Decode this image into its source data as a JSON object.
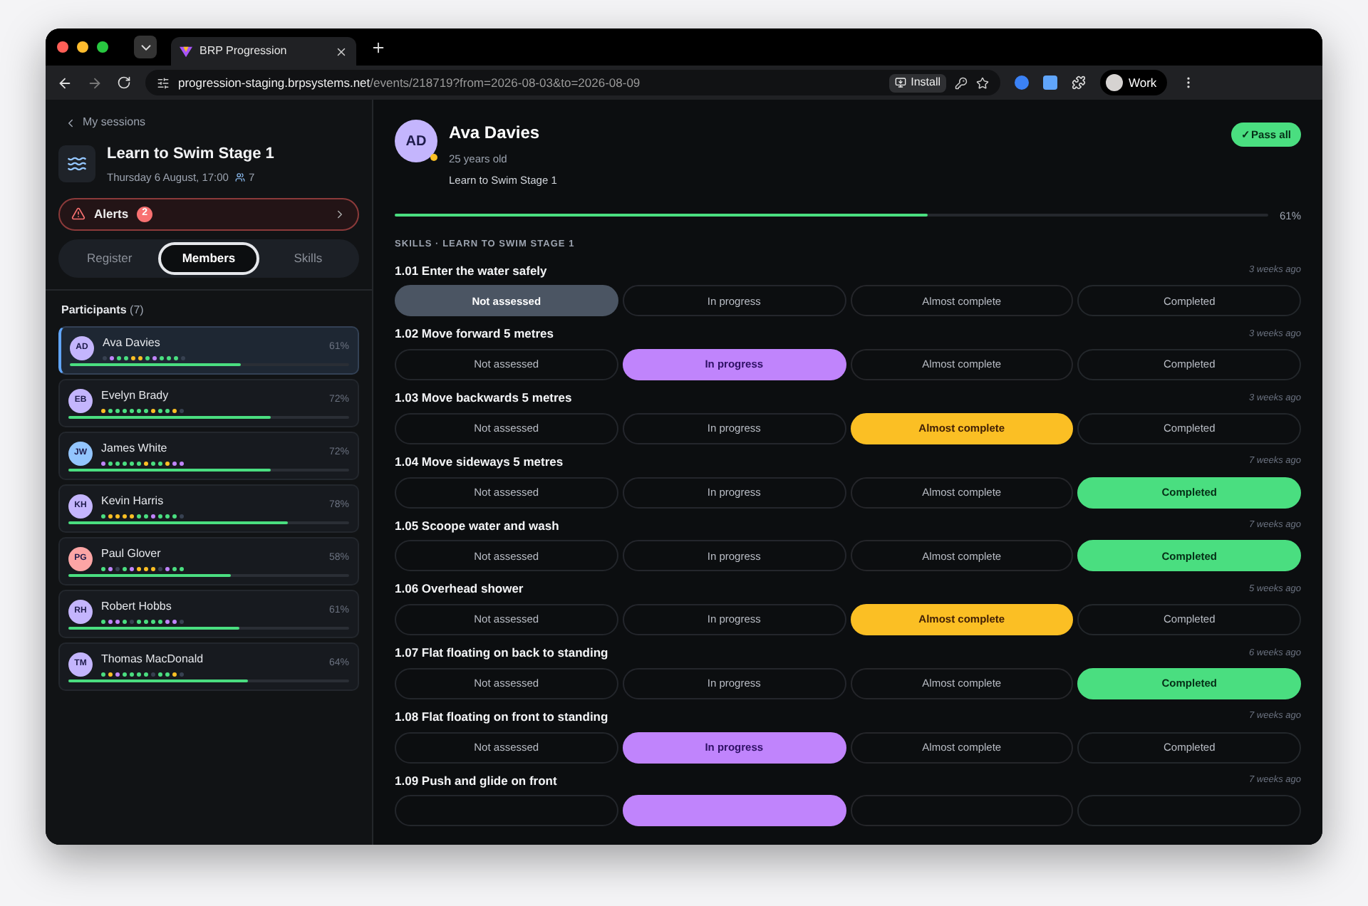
{
  "browser": {
    "tab_title": "BRP Progression",
    "url_host": "progression-staging.brpsystems.net",
    "url_path": "/events/218719?from=2026-08-03&to=2026-08-09",
    "install_label": "Install",
    "profile_label": "Work"
  },
  "sidebar": {
    "back_label": "My sessions",
    "session_title": "Learn to Swim Stage 1",
    "session_time": "Thursday 6 August, 17:00",
    "attendee_count": "7",
    "alerts": {
      "label": "Alerts",
      "count": "2"
    },
    "tabs": [
      {
        "label": "Register",
        "selected": false
      },
      {
        "label": "Members",
        "selected": true
      },
      {
        "label": "Skills",
        "selected": false
      }
    ],
    "participants_heading": "Participants",
    "participants_count": "(7)",
    "participants": [
      {
        "initials": "AD",
        "name": "Ava Davies",
        "percent": "61%",
        "level": 0.61,
        "color": "#c4b5fd",
        "selected": true,
        "dots": [
          {
            "color": "#374151"
          },
          {
            "color": "#c084fc"
          },
          {
            "color": "#4ade80"
          },
          {
            "color": "#4ade80"
          },
          {
            "color": "#fbbf24"
          },
          {
            "color": "#fbbf24"
          },
          {
            "color": "#4ade80"
          },
          {
            "color": "#c084fc"
          },
          {
            "color": "#4ade80"
          },
          {
            "color": "#4ade80"
          },
          {
            "color": "#4ade80"
          },
          {
            "color": "#374151"
          }
        ]
      },
      {
        "initials": "EB",
        "name": "Evelyn Brady",
        "percent": "72%",
        "level": 0.72,
        "color": "#c4b5fd",
        "selected": false,
        "dots": [
          {
            "color": "#fbbf24"
          },
          {
            "color": "#4ade80"
          },
          {
            "color": "#4ade80"
          },
          {
            "color": "#4ade80"
          },
          {
            "color": "#4ade80"
          },
          {
            "color": "#4ade80"
          },
          {
            "color": "#4ade80"
          },
          {
            "color": "#fbbf24"
          },
          {
            "color": "#4ade80"
          },
          {
            "color": "#4ade80"
          },
          {
            "color": "#fbbf24"
          },
          {
            "color": "#374151"
          }
        ]
      },
      {
        "initials": "JW",
        "name": "James White",
        "percent": "72%",
        "level": 0.72,
        "color": "#93c5fd",
        "selected": false,
        "dots": [
          {
            "color": "#c084fc"
          },
          {
            "color": "#4ade80"
          },
          {
            "color": "#4ade80"
          },
          {
            "color": "#4ade80"
          },
          {
            "color": "#4ade80"
          },
          {
            "color": "#4ade80"
          },
          {
            "color": "#fbbf24"
          },
          {
            "color": "#4ade80"
          },
          {
            "color": "#4ade80"
          },
          {
            "color": "#fbbf24"
          },
          {
            "color": "#c084fc"
          },
          {
            "color": "#c084fc"
          }
        ]
      },
      {
        "initials": "KH",
        "name": "Kevin Harris",
        "percent": "78%",
        "level": 0.78,
        "color": "#c4b5fd",
        "selected": false,
        "dots": [
          {
            "color": "#4ade80"
          },
          {
            "color": "#fbbf24"
          },
          {
            "color": "#fbbf24"
          },
          {
            "color": "#fbbf24"
          },
          {
            "color": "#fbbf24"
          },
          {
            "color": "#4ade80"
          },
          {
            "color": "#4ade80"
          },
          {
            "color": "#c084fc"
          },
          {
            "color": "#4ade80"
          },
          {
            "color": "#4ade80"
          },
          {
            "color": "#4ade80"
          },
          {
            "color": "#374151"
          }
        ]
      },
      {
        "initials": "PG",
        "name": "Paul Glover",
        "percent": "58%",
        "level": 0.58,
        "color": "#fca5a5",
        "selected": false,
        "dots": [
          {
            "color": "#4ade80"
          },
          {
            "color": "#c084fc"
          },
          {
            "color": "#374151"
          },
          {
            "color": "#4ade80"
          },
          {
            "color": "#c084fc"
          },
          {
            "color": "#fbbf24"
          },
          {
            "color": "#fbbf24"
          },
          {
            "color": "#fbbf24"
          },
          {
            "color": "#374151"
          },
          {
            "color": "#c084fc"
          },
          {
            "color": "#4ade80"
          },
          {
            "color": "#4ade80"
          }
        ]
      },
      {
        "initials": "RH",
        "name": "Robert Hobbs",
        "percent": "61%",
        "level": 0.61,
        "color": "#c4b5fd",
        "selected": false,
        "dots": [
          {
            "color": "#4ade80"
          },
          {
            "color": "#c084fc"
          },
          {
            "color": "#c084fc"
          },
          {
            "color": "#4ade80"
          },
          {
            "color": "#374151"
          },
          {
            "color": "#4ade80"
          },
          {
            "color": "#4ade80"
          },
          {
            "color": "#4ade80"
          },
          {
            "color": "#4ade80"
          },
          {
            "color": "#c084fc"
          },
          {
            "color": "#c084fc"
          },
          {
            "color": "#374151"
          }
        ]
      },
      {
        "initials": "TM",
        "name": "Thomas MacDonald",
        "percent": "64%",
        "level": 0.64,
        "color": "#c4b5fd",
        "selected": false,
        "dots": [
          {
            "color": "#4ade80"
          },
          {
            "color": "#fbbf24"
          },
          {
            "color": "#c084fc"
          },
          {
            "color": "#4ade80"
          },
          {
            "color": "#4ade80"
          },
          {
            "color": "#4ade80"
          },
          {
            "color": "#4ade80"
          },
          {
            "color": "#374151"
          },
          {
            "color": "#4ade80"
          },
          {
            "color": "#4ade80"
          },
          {
            "color": "#fbbf24"
          },
          {
            "color": "#374151"
          }
        ]
      }
    ]
  },
  "member": {
    "initials": "AD",
    "name": "Ava Davies",
    "age": "25 years old",
    "course": "Learn to Swim Stage 1",
    "pass_all_label": "✓Pass all",
    "level": 0.61,
    "percent": "61%",
    "skills_heading": "SKILLS · LEARN TO SWIM STAGE 1",
    "skills": [
      {
        "title": "1.01 Enter the water safely",
        "time": "3 weeks ago",
        "options": [
          {
            "kind": "not_assessed",
            "label": "Not assessed",
            "selected": true
          },
          {
            "kind": "in_progress",
            "label": "In progress",
            "selected": false
          },
          {
            "kind": "almost",
            "label": "Almost complete",
            "selected": false
          },
          {
            "kind": "completed",
            "label": "Completed",
            "selected": false
          }
        ]
      },
      {
        "title": "1.02 Move forward 5 metres",
        "time": "3 weeks ago",
        "options": [
          {
            "kind": "not_assessed",
            "label": "Not assessed",
            "selected": false
          },
          {
            "kind": "in_progress",
            "label": "In progress",
            "selected": true
          },
          {
            "kind": "almost",
            "label": "Almost complete",
            "selected": false
          },
          {
            "kind": "completed",
            "label": "Completed",
            "selected": false
          }
        ]
      },
      {
        "title": "1.03 Move backwards 5 metres",
        "time": "3 weeks ago",
        "options": [
          {
            "kind": "not_assessed",
            "label": "Not assessed",
            "selected": false
          },
          {
            "kind": "in_progress",
            "label": "In progress",
            "selected": false
          },
          {
            "kind": "almost",
            "label": "Almost complete",
            "selected": true
          },
          {
            "kind": "completed",
            "label": "Completed",
            "selected": false
          }
        ]
      },
      {
        "title": "1.04 Move sideways 5 metres",
        "time": "7 weeks ago",
        "options": [
          {
            "kind": "not_assessed",
            "label": "Not assessed",
            "selected": false
          },
          {
            "kind": "in_progress",
            "label": "In progress",
            "selected": false
          },
          {
            "kind": "almost",
            "label": "Almost complete",
            "selected": false
          },
          {
            "kind": "completed",
            "label": "Completed",
            "selected": true
          }
        ]
      },
      {
        "title": "1.05 Scoope water and wash",
        "time": "7 weeks ago",
        "options": [
          {
            "kind": "not_assessed",
            "label": "Not assessed",
            "selected": false
          },
          {
            "kind": "in_progress",
            "label": "In progress",
            "selected": false
          },
          {
            "kind": "almost",
            "label": "Almost complete",
            "selected": false
          },
          {
            "kind": "completed",
            "label": "Completed",
            "selected": true
          }
        ]
      },
      {
        "title": "1.06 Overhead shower",
        "time": "5 weeks ago",
        "options": [
          {
            "kind": "not_assessed",
            "label": "Not assessed",
            "selected": false
          },
          {
            "kind": "in_progress",
            "label": "In progress",
            "selected": false
          },
          {
            "kind": "almost",
            "label": "Almost complete",
            "selected": true
          },
          {
            "kind": "completed",
            "label": "Completed",
            "selected": false
          }
        ]
      },
      {
        "title": "1.07 Flat floating on back to standing",
        "time": "6 weeks ago",
        "options": [
          {
            "kind": "not_assessed",
            "label": "Not assessed",
            "selected": false
          },
          {
            "kind": "in_progress",
            "label": "In progress",
            "selected": false
          },
          {
            "kind": "almost",
            "label": "Almost complete",
            "selected": false
          },
          {
            "kind": "completed",
            "label": "Completed",
            "selected": true
          }
        ]
      },
      {
        "title": "1.08 Flat floating on front to standing",
        "time": "7 weeks ago",
        "options": [
          {
            "kind": "not_assessed",
            "label": "Not assessed",
            "selected": false
          },
          {
            "kind": "in_progress",
            "label": "In progress",
            "selected": true
          },
          {
            "kind": "almost",
            "label": "Almost complete",
            "selected": false
          },
          {
            "kind": "completed",
            "label": "Completed",
            "selected": false
          }
        ]
      },
      {
        "title": "1.09 Push and glide on front",
        "time": "7 weeks ago",
        "options": [
          {
            "kind": "not_assessed",
            "selected": false
          },
          {
            "kind": "in_progress",
            "selected": true
          },
          {
            "kind": "almost",
            "selected": false
          },
          {
            "kind": "completed",
            "selected": false
          }
        ]
      }
    ]
  }
}
